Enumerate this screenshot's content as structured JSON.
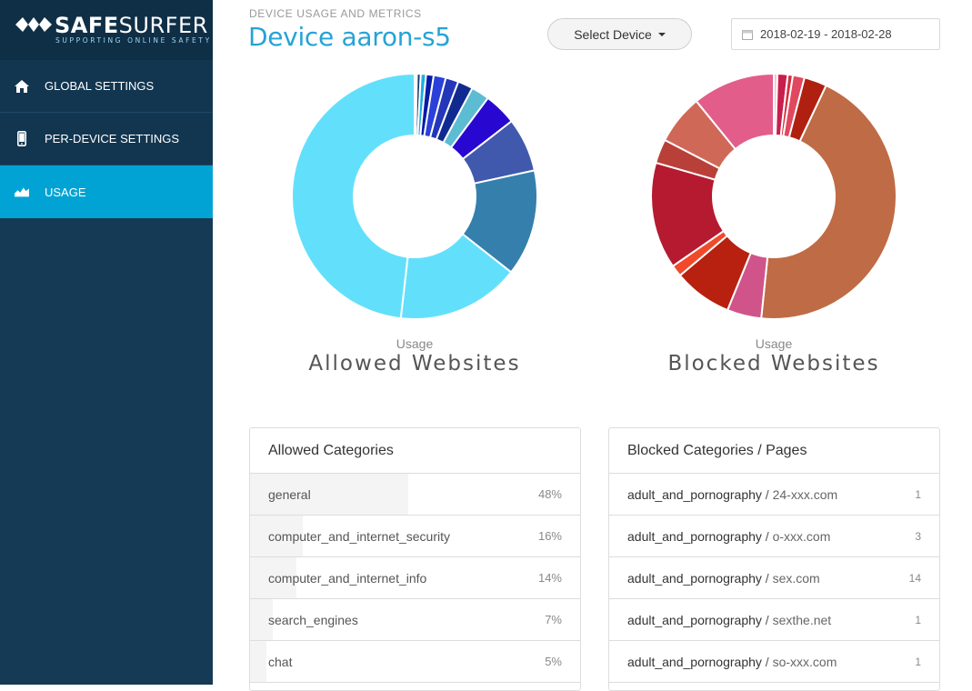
{
  "brand": {
    "name_bold": "SAFE",
    "name_light": "SURFER",
    "tagline": "SUPPORTING ONLINE SAFETY"
  },
  "sidebar": {
    "items": [
      {
        "label": "GLOBAL SETTINGS",
        "icon": "home-icon"
      },
      {
        "label": "PER-DEVICE SETTINGS",
        "icon": "phone-icon"
      },
      {
        "label": "USAGE",
        "icon": "chart-icon",
        "active": true
      }
    ]
  },
  "header": {
    "subtitle": "DEVICE USAGE AND METRICS",
    "title": "Device aaron-s5",
    "select_device": "Select Device",
    "date_range": "2018-02-19 - 2018-02-28"
  },
  "chart_data": [
    {
      "type": "pie",
      "title": "Allowed Websites",
      "subtitle": "Usage",
      "donut": true,
      "values": [
        0.3,
        0.5,
        0.7,
        1.0,
        1.6,
        1.7,
        2.0,
        2.4,
        4.3,
        7.1,
        14.0,
        16.2,
        48.2
      ],
      "colors": [
        "#dde8f0",
        "#1a3a6a",
        "#1faee0",
        "#0a1aa8",
        "#2a40d8",
        "#2437b8",
        "#102a90",
        "#5bbcd2",
        "#2808d0",
        "#4059ad",
        "#357fad",
        "#62e0fb",
        "#62e0fb"
      ]
    },
    {
      "type": "pie",
      "title": "Blocked Websites",
      "subtitle": "Usage",
      "donut": true,
      "values": [
        0.5,
        1.4,
        0.7,
        1.6,
        3.1,
        46.4,
        4.7,
        8.0,
        1.6,
        14.6,
        3.3,
        6.8,
        11.3
      ],
      "colors": [
        "#f7c4c4",
        "#c81e4e",
        "#d62e3e",
        "#e04860",
        "#b02010",
        "#bf6b45",
        "#d0548a",
        "#b82010",
        "#f04a2a",
        "#b51a30",
        "#b84038",
        "#d06858",
        "#e35d8a"
      ]
    }
  ],
  "allowed": {
    "heading": "Allowed Categories",
    "rows": [
      {
        "label": "general",
        "value": "48%",
        "pct": 48
      },
      {
        "label": "computer_and_internet_security",
        "value": "16%",
        "pct": 16
      },
      {
        "label": "computer_and_internet_info",
        "value": "14%",
        "pct": 14
      },
      {
        "label": "search_engines",
        "value": "7%",
        "pct": 7
      },
      {
        "label": "chat",
        "value": "5%",
        "pct": 5
      }
    ]
  },
  "blocked": {
    "heading": "Blocked Categories / Pages",
    "rows": [
      {
        "category": "adult_and_pornography",
        "page": "24-xxx.com",
        "count": "1"
      },
      {
        "category": "adult_and_pornography",
        "page": "o-xxx.com",
        "count": "3"
      },
      {
        "category": "adult_and_pornography",
        "page": "sex.com",
        "count": "14"
      },
      {
        "category": "adult_and_pornography",
        "page": "sexthe.net",
        "count": "1"
      },
      {
        "category": "adult_and_pornography",
        "page": "so-xxx.com",
        "count": "1"
      }
    ]
  }
}
